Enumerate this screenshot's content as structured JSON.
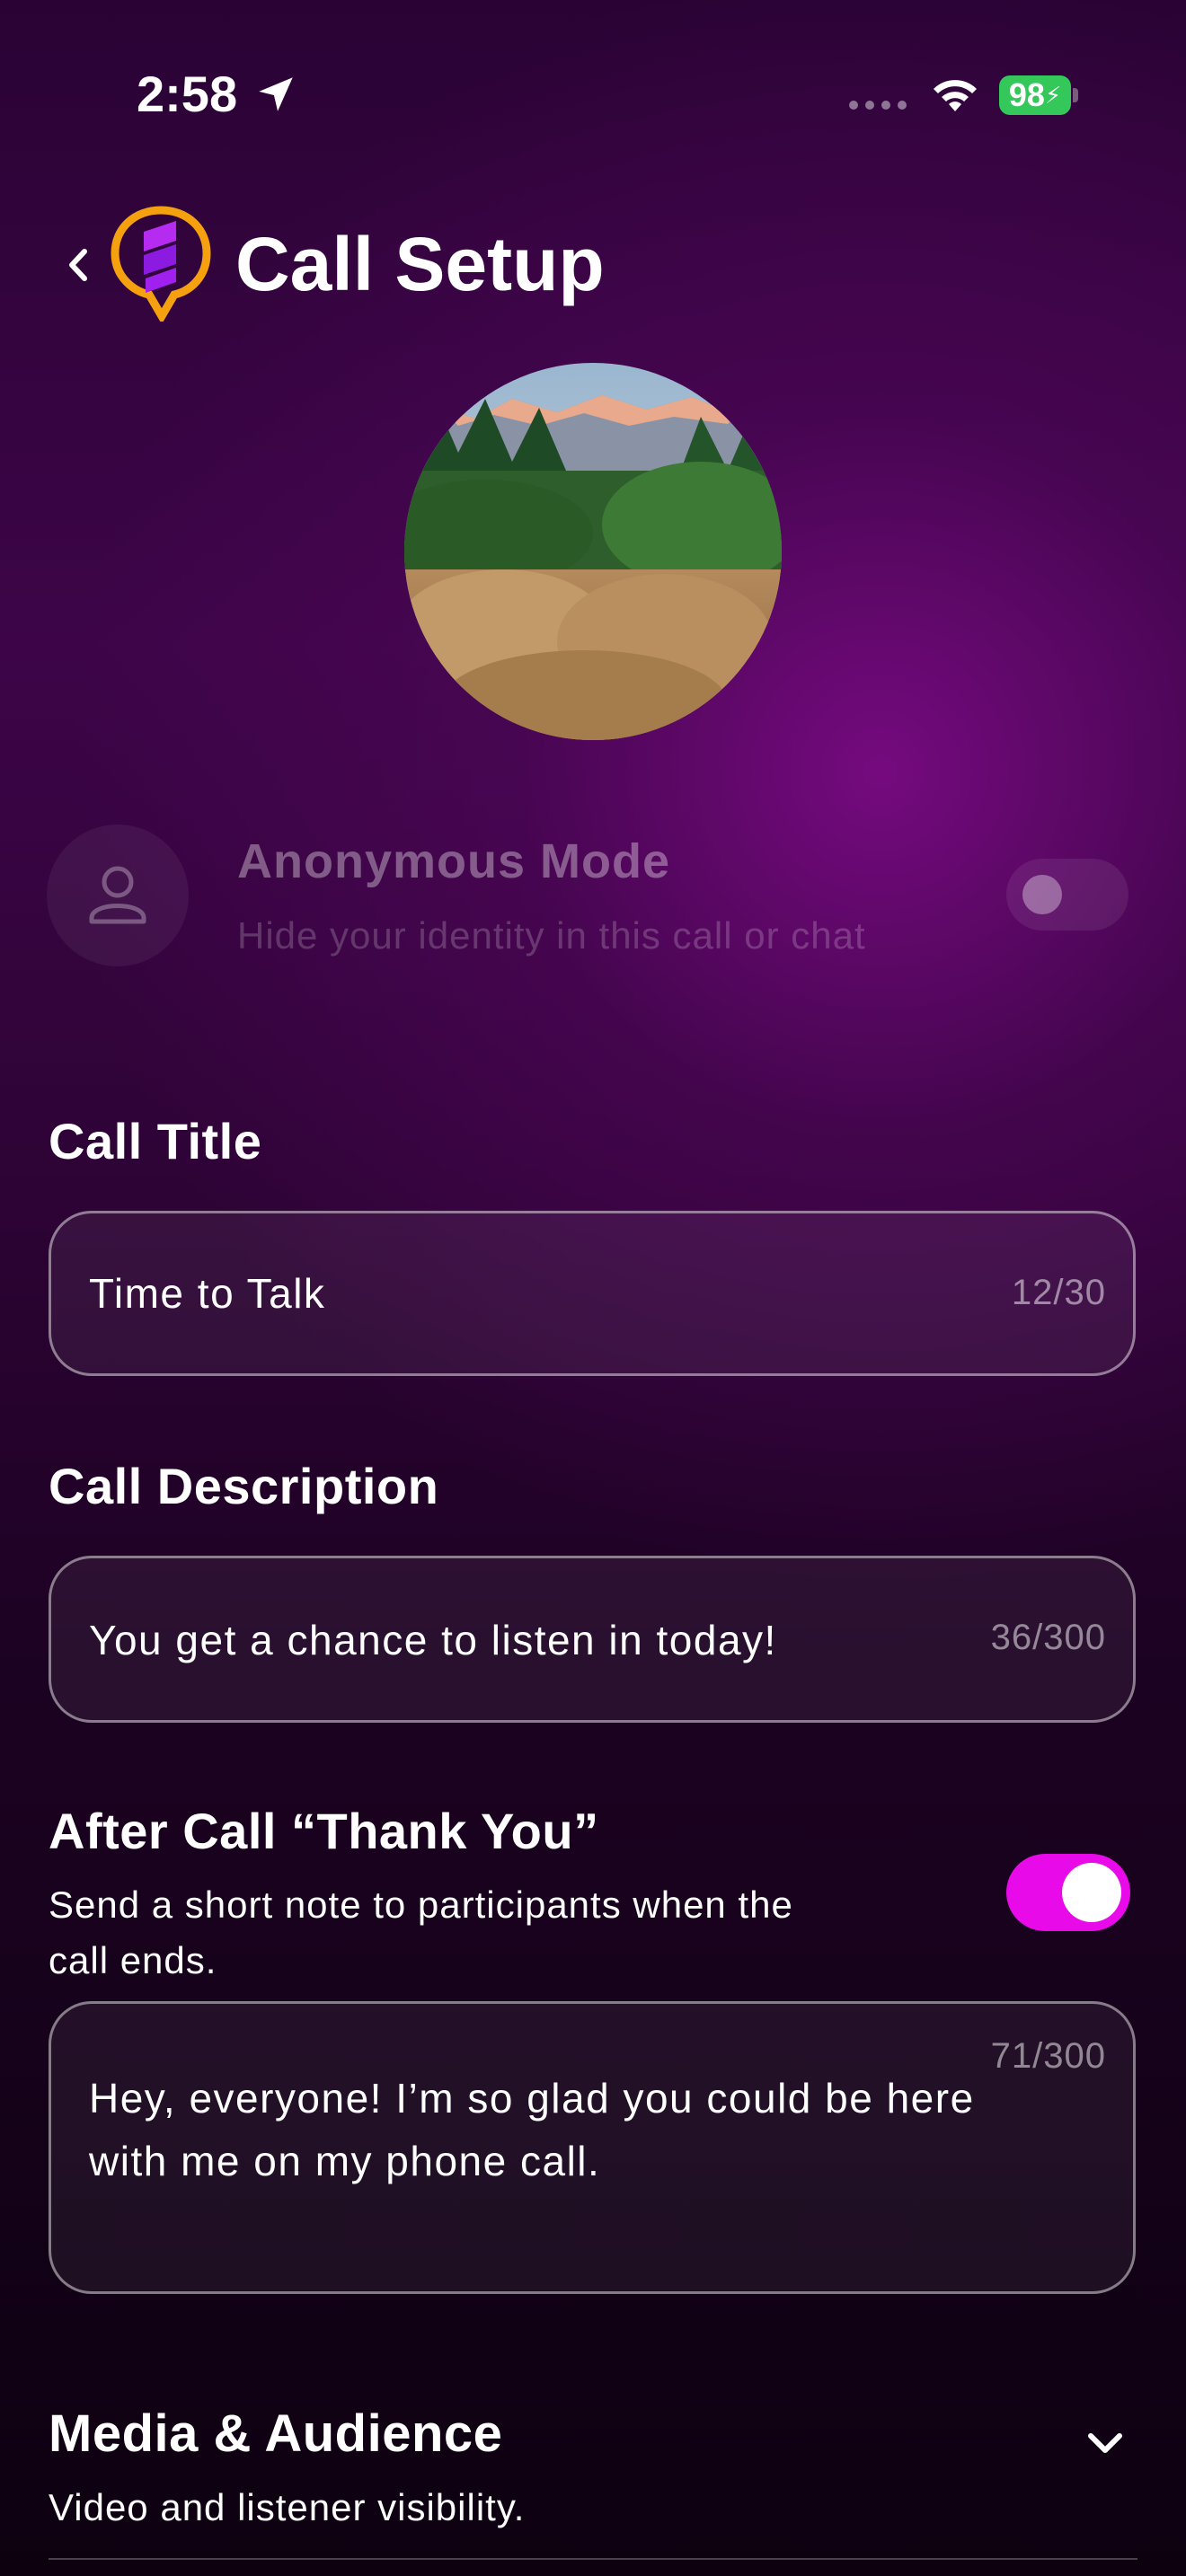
{
  "status_bar": {
    "time": "2:58",
    "battery": "98"
  },
  "header": {
    "title": "Call Setup"
  },
  "anonymous_mode": {
    "title": "Anonymous Mode",
    "subtitle": "Hide your identity in this call or chat",
    "enabled": false
  },
  "call_title": {
    "label": "Call Title",
    "value": "Time to Talk",
    "counter": "12/30"
  },
  "call_description": {
    "label": "Call Description",
    "value": "You get a chance to listen in today!",
    "counter": "36/300"
  },
  "thank_you": {
    "label": "After Call “Thank You”",
    "subtitle": "Send a short note to participants when the call ends.",
    "enabled": true,
    "value": "Hey, everyone! I’m so glad you could be here with me on my phone call.",
    "counter": "71/300"
  },
  "media_audience": {
    "title": "Media & Audience",
    "subtitle": "Video and listener visibility."
  },
  "colors": {
    "accent": "#e80ae8",
    "battery": "#34c759",
    "logo_orange": "#f5a10f",
    "logo_purple": "#a020f0"
  },
  "icons": [
    "location-arrow-icon",
    "cellular-dots-icon",
    "wifi-icon",
    "battery-icon",
    "back-chevron-icon",
    "app-logo-icon",
    "person-icon",
    "chevron-down-icon"
  ]
}
